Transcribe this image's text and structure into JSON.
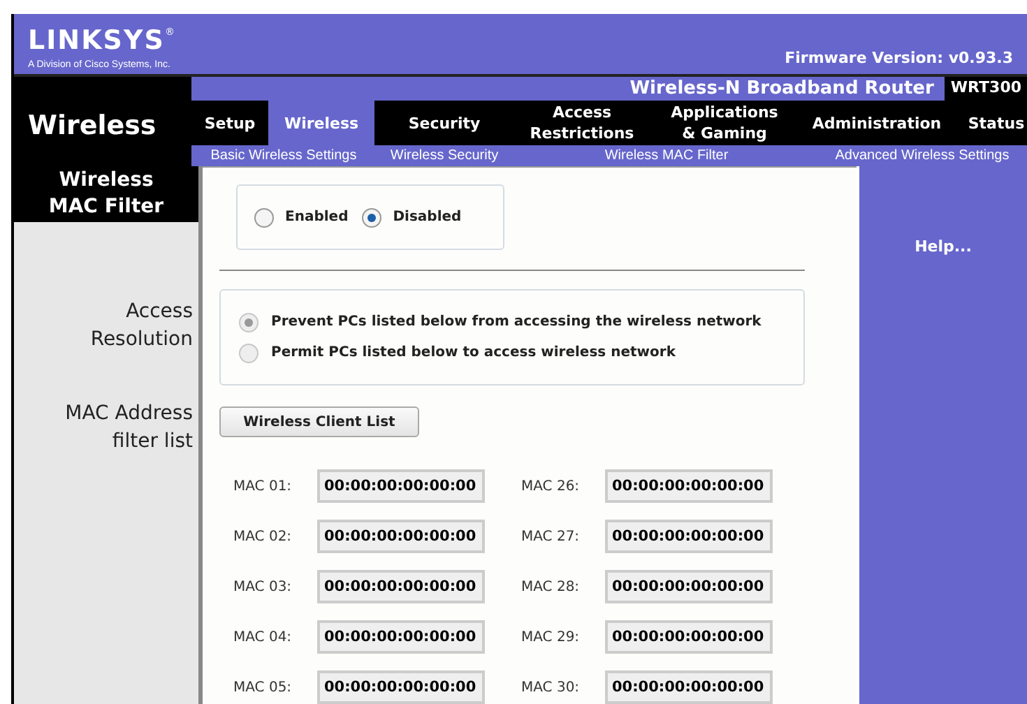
{
  "header": {
    "logo": "LINKSYS",
    "logo_mark": "®",
    "tagline": "A Division of Cisco Systems, Inc.",
    "firmware": "Firmware Version: v0.93.3"
  },
  "product": {
    "name": "Wireless-N Broadband Router",
    "model": "WRT300"
  },
  "section_title": "Wireless",
  "tabs": [
    {
      "label": "Setup",
      "selected": false
    },
    {
      "label": "Wireless",
      "selected": true
    },
    {
      "label": "Security",
      "selected": false
    },
    {
      "label": "Access Restrictions",
      "selected": false
    },
    {
      "label": "Applications & Gaming",
      "selected": false
    },
    {
      "label": "Administration",
      "selected": false
    },
    {
      "label": "Status",
      "selected": false
    }
  ],
  "subtabs": [
    "Basic Wireless Settings",
    "Wireless Security",
    "Wireless MAC Filter",
    "Advanced Wireless Settings"
  ],
  "sidebar": {
    "title": "Wireless MAC Filter",
    "labels": [
      "Access Resolution",
      "MAC Address filter list"
    ]
  },
  "filter_mode": [
    {
      "label": "Enabled",
      "selected": false
    },
    {
      "label": "Disabled",
      "selected": true
    }
  ],
  "access_resolution": [
    {
      "label": "Prevent PCs listed below from accessing the wireless network",
      "selected": true
    },
    {
      "label": "Permit PCs listed below to access wireless network",
      "selected": false
    }
  ],
  "client_list_button": "Wireless Client List",
  "mac_rows": [
    [
      {
        "label": "MAC 01:",
        "value": "00:00:00:00:00:00"
      },
      {
        "label": "MAC 26:",
        "value": "00:00:00:00:00:00"
      }
    ],
    [
      {
        "label": "MAC 02:",
        "value": "00:00:00:00:00:00"
      },
      {
        "label": "MAC 27:",
        "value": "00:00:00:00:00:00"
      }
    ],
    [
      {
        "label": "MAC 03:",
        "value": "00:00:00:00:00:00"
      },
      {
        "label": "MAC 28:",
        "value": "00:00:00:00:00:00"
      }
    ],
    [
      {
        "label": "MAC 04:",
        "value": "00:00:00:00:00:00"
      },
      {
        "label": "MAC 29:",
        "value": "00:00:00:00:00:00"
      }
    ],
    [
      {
        "label": "MAC 05:",
        "value": "00:00:00:00:00:00"
      },
      {
        "label": "MAC 30:",
        "value": "00:00:00:00:00:00"
      }
    ]
  ],
  "help": "Help..."
}
